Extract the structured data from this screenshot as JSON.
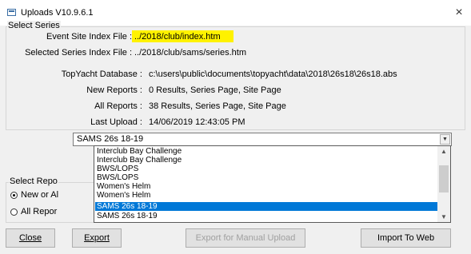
{
  "window": {
    "title": "Uploads V10.9.6.1",
    "close_glyph": "×"
  },
  "series_group": {
    "label": "Select Series",
    "rows": [
      {
        "label": "Event Site Index File :",
        "value": "../2018/club/index.htm"
      },
      {
        "label": "Selected Series Index File :",
        "value": "../2018/club/sams/series.htm"
      },
      {
        "label": "TopYacht Database :",
        "value": "c:\\users\\public\\documents\\topyacht\\data\\2018\\26s18\\26s18.abs"
      },
      {
        "label": "New Reports :",
        "value": "0 Results, Series Page, Site Page"
      },
      {
        "label": "All Reports :",
        "value": "38 Results, Series Page, Site Page"
      },
      {
        "label": "Last Upload :",
        "value": "14/06/2019 12:43:05 PM"
      }
    ]
  },
  "series_combo": {
    "selected": "SAMS 26s 18-19",
    "options": [
      "Interclub Bay Challenge",
      "Interclub Bay Challenge",
      "BWS/LOPS",
      "BWS/LOPS",
      "Women's Helm",
      "Women's Helm",
      "SAMS 26s 18-19",
      "SAMS 26s 18-19"
    ],
    "highlighted_index": 6
  },
  "reports_group": {
    "label": "Select Repo",
    "options": [
      {
        "label": "New or Al",
        "checked": true
      },
      {
        "label": "All Repor",
        "checked": false
      }
    ]
  },
  "buttons": {
    "close_label": "Close",
    "export_label": "Export",
    "export_manual_label": "Export for Manual Upload",
    "import_label": "Import To Web"
  },
  "colors": {
    "highlight": "#fff200",
    "selection": "#0078d7"
  }
}
